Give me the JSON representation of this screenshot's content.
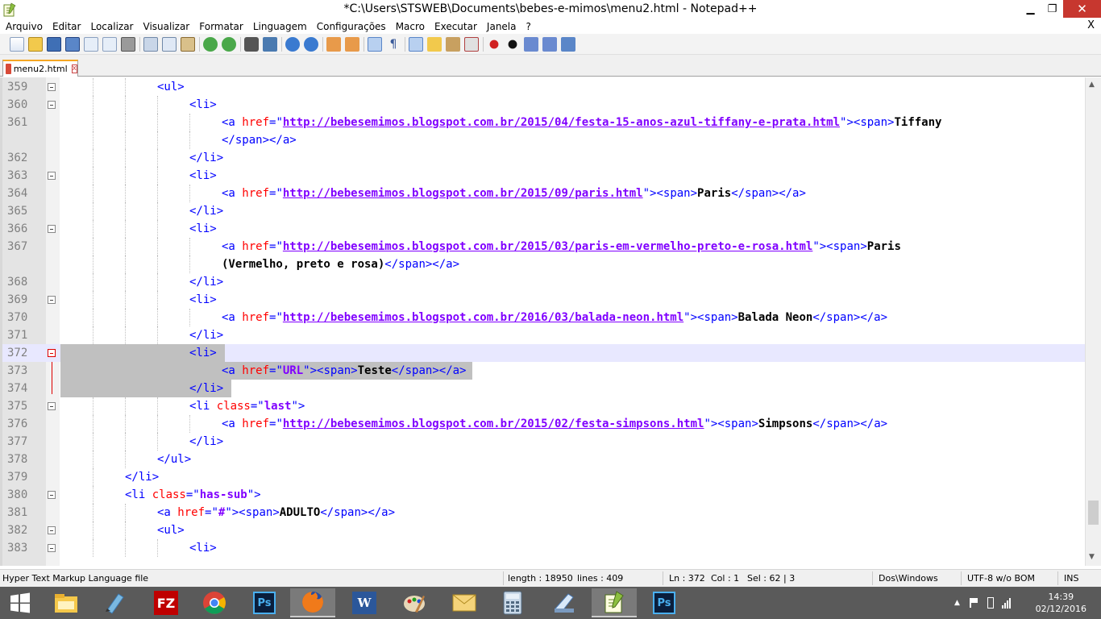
{
  "window": {
    "title": "*C:\\Users\\STSWEB\\Documents\\bebes-e-mimos\\menu2.html - Notepad++",
    "minimize": "▁",
    "restore": "❐",
    "close": "✕"
  },
  "menu": {
    "items": [
      "Arquivo",
      "Editar",
      "Localizar",
      "Visualizar",
      "Formatar",
      "Linguagem",
      "Configurações",
      "Macro",
      "Executar",
      "Janela",
      "?"
    ],
    "close": "X"
  },
  "tab": {
    "label": "menu2.html",
    "close": "x"
  },
  "editor": {
    "lines": [
      {
        "n": "359",
        "fold": true,
        "indent": 3,
        "segs": [
          [
            "tag",
            "<ul>"
          ]
        ]
      },
      {
        "n": "360",
        "fold": true,
        "indent": 4,
        "segs": [
          [
            "tag",
            "<li>"
          ]
        ]
      },
      {
        "n": "361",
        "fold": false,
        "indent": 5,
        "segs": [
          [
            "tag",
            "<a "
          ],
          [
            "attr",
            "href"
          ],
          [
            "tag",
            "=\""
          ],
          [
            "url",
            "http://bebesemimos.blogspot.com.br/2015/04/festa-15-anos-azul-tiffany-e-prata.html"
          ],
          [
            "tag",
            "\"><span>"
          ],
          [
            "txt",
            "Tiffany"
          ]
        ]
      },
      {
        "n": "",
        "fold": false,
        "indent": 5,
        "segs": [
          [
            "tag",
            "</span></a>"
          ]
        ]
      },
      {
        "n": "362",
        "fold": false,
        "indent": 4,
        "segs": [
          [
            "tag",
            "</li>"
          ]
        ]
      },
      {
        "n": "363",
        "fold": true,
        "indent": 4,
        "segs": [
          [
            "tag",
            "<li>"
          ]
        ]
      },
      {
        "n": "364",
        "fold": false,
        "indent": 5,
        "segs": [
          [
            "tag",
            "<a "
          ],
          [
            "attr",
            "href"
          ],
          [
            "tag",
            "=\""
          ],
          [
            "url",
            "http://bebesemimos.blogspot.com.br/2015/09/paris.html"
          ],
          [
            "tag",
            "\"><span>"
          ],
          [
            "txt",
            "Paris"
          ],
          [
            "tag",
            "</span></a>"
          ]
        ]
      },
      {
        "n": "365",
        "fold": false,
        "indent": 4,
        "segs": [
          [
            "tag",
            "</li>"
          ]
        ]
      },
      {
        "n": "366",
        "fold": true,
        "indent": 4,
        "segs": [
          [
            "tag",
            "<li>"
          ]
        ]
      },
      {
        "n": "367",
        "fold": false,
        "indent": 5,
        "segs": [
          [
            "tag",
            "<a "
          ],
          [
            "attr",
            "href"
          ],
          [
            "tag",
            "=\""
          ],
          [
            "url",
            "http://bebesemimos.blogspot.com.br/2015/03/paris-em-vermelho-preto-e-rosa.html"
          ],
          [
            "tag",
            "\"><span>"
          ],
          [
            "txt",
            "Paris"
          ]
        ]
      },
      {
        "n": "",
        "fold": false,
        "indent": 5,
        "segs": [
          [
            "txt",
            "(Vermelho, preto e rosa)"
          ],
          [
            "tag",
            "</span></a>"
          ]
        ]
      },
      {
        "n": "368",
        "fold": false,
        "indent": 4,
        "segs": [
          [
            "tag",
            "</li>"
          ]
        ]
      },
      {
        "n": "369",
        "fold": true,
        "indent": 4,
        "segs": [
          [
            "tag",
            "<li>"
          ]
        ]
      },
      {
        "n": "370",
        "fold": false,
        "indent": 5,
        "segs": [
          [
            "tag",
            "<a "
          ],
          [
            "attr",
            "href"
          ],
          [
            "tag",
            "=\""
          ],
          [
            "url",
            "http://bebesemimos.blogspot.com.br/2016/03/balada-neon.html"
          ],
          [
            "tag",
            "\"><span>"
          ],
          [
            "txt",
            "Balada Neon"
          ],
          [
            "tag",
            "</span></a>"
          ]
        ]
      },
      {
        "n": "371",
        "fold": false,
        "indent": 4,
        "segs": [
          [
            "tag",
            "</li>"
          ]
        ]
      },
      {
        "n": "372",
        "fold": true,
        "indent": 4,
        "sel": true,
        "current": true,
        "segs": [
          [
            "tag",
            "<li>"
          ]
        ]
      },
      {
        "n": "373",
        "fold": false,
        "indent": 5,
        "sel": true,
        "segs": [
          [
            "tag",
            "<a "
          ],
          [
            "attr",
            "href"
          ],
          [
            "tag",
            "=\""
          ],
          [
            "val",
            "URL"
          ],
          [
            "tag",
            "\"><span>"
          ],
          [
            "txt",
            "Teste"
          ],
          [
            "tag",
            "</span></a>"
          ]
        ]
      },
      {
        "n": "374",
        "fold": false,
        "indent": 4,
        "sel": true,
        "segs": [
          [
            "tag",
            "</li>"
          ]
        ]
      },
      {
        "n": "375",
        "fold": true,
        "indent": 4,
        "segs": [
          [
            "tag",
            "<li "
          ],
          [
            "attr",
            "class"
          ],
          [
            "tag",
            "=\""
          ],
          [
            "val",
            "last"
          ],
          [
            "tag",
            "\">"
          ]
        ]
      },
      {
        "n": "376",
        "fold": false,
        "indent": 5,
        "segs": [
          [
            "tag",
            "<a "
          ],
          [
            "attr",
            "href"
          ],
          [
            "tag",
            "=\""
          ],
          [
            "url",
            "http://bebesemimos.blogspot.com.br/2015/02/festa-simpsons.html"
          ],
          [
            "tag",
            "\"><span>"
          ],
          [
            "txt",
            "Simpsons"
          ],
          [
            "tag",
            "</span></a>"
          ]
        ]
      },
      {
        "n": "377",
        "fold": false,
        "indent": 4,
        "segs": [
          [
            "tag",
            "</li>"
          ]
        ]
      },
      {
        "n": "378",
        "fold": false,
        "indent": 3,
        "segs": [
          [
            "tag",
            "</ul>"
          ]
        ]
      },
      {
        "n": "379",
        "fold": false,
        "indent": 2,
        "segs": [
          [
            "tag",
            "</li>"
          ]
        ]
      },
      {
        "n": "380",
        "fold": true,
        "indent": 2,
        "segs": [
          [
            "tag",
            "<li "
          ],
          [
            "attr",
            "class"
          ],
          [
            "tag",
            "=\""
          ],
          [
            "val",
            "has-sub"
          ],
          [
            "tag",
            "\">"
          ]
        ]
      },
      {
        "n": "381",
        "fold": false,
        "indent": 3,
        "segs": [
          [
            "tag",
            "<a "
          ],
          [
            "attr",
            "href"
          ],
          [
            "tag",
            "=\""
          ],
          [
            "val",
            "#"
          ],
          [
            "tag",
            "\"><span>"
          ],
          [
            "txt",
            "ADULTO"
          ],
          [
            "tag",
            "</span></a>"
          ]
        ]
      },
      {
        "n": "382",
        "fold": true,
        "indent": 3,
        "segs": [
          [
            "tag",
            "<ul>"
          ]
        ]
      },
      {
        "n": "383",
        "fold": true,
        "indent": 4,
        "segs": [
          [
            "tag",
            "<li>"
          ]
        ]
      }
    ]
  },
  "status": {
    "filetype": "Hyper Text Markup Language file",
    "length": "length : 18950",
    "lines": "lines : 409",
    "ln": "Ln : 372",
    "col": "Col : 1",
    "sel": "Sel : 62 | 3",
    "eol": "Dos\\Windows",
    "encoding": "UTF-8 w/o BOM",
    "mode": "INS"
  },
  "taskbar": {
    "apps": [
      "start-button",
      "file-explorer-icon",
      "notepad-icon",
      "filezilla-icon",
      "chrome-icon",
      "photoshop-icon",
      "firefox-icon",
      "word-icon",
      "paint-icon",
      "outlook-icon",
      "calculator-icon",
      "scanner-icon",
      "notepadpp-icon",
      "photoshop-icon-2"
    ],
    "filezilla_label": "FZ",
    "ps_label": "Ps",
    "ps_label_2": "Ps",
    "word_label": "W",
    "time": "14:39",
    "date": "02/12/2016"
  },
  "colors": {
    "tag": "#0000ff",
    "attr": "#ff0000",
    "value": "#8000ff",
    "selection": "#c0c0c0",
    "current_line": "#e8e8ff",
    "close_button": "#c7372f",
    "taskbar": "#5a5a5a"
  }
}
